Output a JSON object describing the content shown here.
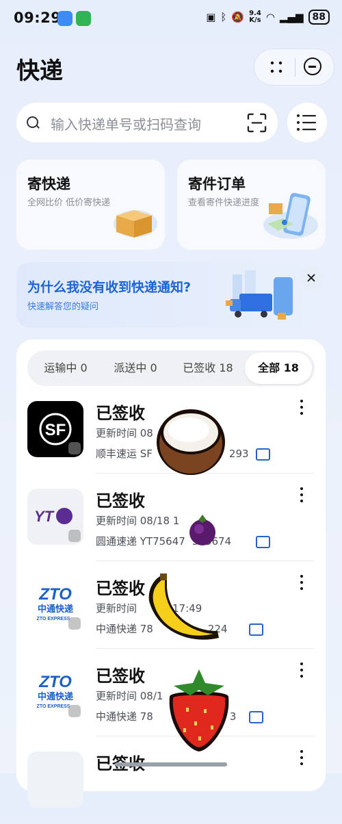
{
  "status_bar": {
    "time": "09:29",
    "speed_value": "9.4",
    "speed_unit": "K/s",
    "battery": "88"
  },
  "header": {
    "title": "快递"
  },
  "search": {
    "placeholder": "输入快递单号或扫码查询"
  },
  "cards": [
    {
      "title": "寄快递",
      "subtitle": "全网比价 低价寄快递"
    },
    {
      "title": "寄件订单",
      "subtitle": "查看寄件快递进度"
    }
  ],
  "banner": {
    "title": "为什么我没有收到快递通知?",
    "subtitle": "快速解答您的疑问"
  },
  "tabs": [
    {
      "label": "运输中 0"
    },
    {
      "label": "派送中 0"
    },
    {
      "label": "已签收 18"
    },
    {
      "label": "全部 18"
    }
  ],
  "shipments": [
    {
      "status": "已签收",
      "time_text": "更新时间 08",
      "tracking_text": "顺丰速运 SF",
      "tracking_tail": "293",
      "logo_text": "SF"
    },
    {
      "status": "已签收",
      "time_text": "更新时间 08/18 1",
      "tracking_text": "圆通速递 YT75647",
      "tracking_tail": "543674",
      "logo_text": "YT"
    },
    {
      "status": "已签收",
      "time_text": "更新时间",
      "time_tail": "17:49",
      "tracking_text": "中通快递 78",
      "tracking_tail": "224",
      "logo_text": "ZTO",
      "logo_cn": "中通快递",
      "logo_en": "ZTO EXPRESS"
    },
    {
      "status": "已签收",
      "time_text": "更新时间 08/1",
      "tracking_text": "中通快递 78",
      "tracking_tail": "3",
      "logo_text": "ZTO",
      "logo_cn": "中通快递",
      "logo_en": "ZTO EXPRESS"
    },
    {
      "status": "已签收"
    }
  ]
}
